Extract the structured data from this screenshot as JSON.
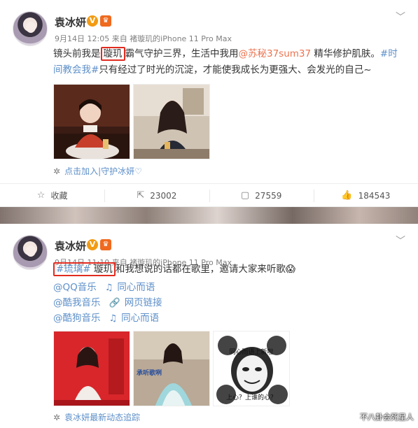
{
  "post1": {
    "author": "袁冰妍",
    "meta": "9月14日 12:05 来自 褚璇玑的iPhone 11 Pro Max",
    "text_parts": [
      "镜头前我是",
      "璇玑",
      "霸气守护三界，生活中我用",
      "@苏秘37sum37",
      " 精华修护肌肤。",
      "#时间教会我#",
      "只有经过了时光的沉淀，才能使我成长为更强大、会发光的自己~"
    ],
    "footer_note": "点击加入|守护冰妍♡",
    "actions": [
      {
        "icon": "star-icon",
        "glyph": "☆",
        "label": "收藏"
      },
      {
        "icon": "share-icon",
        "glyph": "⇱",
        "label": "23002"
      },
      {
        "icon": "comment-icon",
        "glyph": "▢",
        "label": "27559"
      },
      {
        "icon": "like-icon",
        "glyph": "👍",
        "label": "184543"
      }
    ]
  },
  "post2": {
    "author": "袁冰妍",
    "meta": "9月14日 11:10 来自 褚璇玑的iPhone 11 Pro Max",
    "text_parts": [
      "#琉璃#",
      " 璇玑",
      "和我想说的话都在歌里，邀请大家来听歌😱"
    ],
    "music": [
      {
        "site": "@QQ音乐",
        "icon": "music-icon",
        "glyph": "♫",
        "label": "同心而语"
      },
      {
        "site": "@酷我音乐",
        "icon": "link-icon",
        "glyph": "🔗",
        "label": "网页链接"
      },
      {
        "site": "@酷狗音乐",
        "icon": "music-icon",
        "glyph": "♫",
        "label": "同心而语"
      }
    ],
    "footer_note": "袁冰妍最新动态追踪",
    "meme_top": "同心而语上新啦",
    "meme_bottom": "上心？上谁的心？",
    "photo_caption": "承听歌咧"
  },
  "watermark": "不八卦会死星人",
  "colors": {
    "link": "#eb7350",
    "topic": "#5d8fc9",
    "highlight": "#e12b20"
  }
}
